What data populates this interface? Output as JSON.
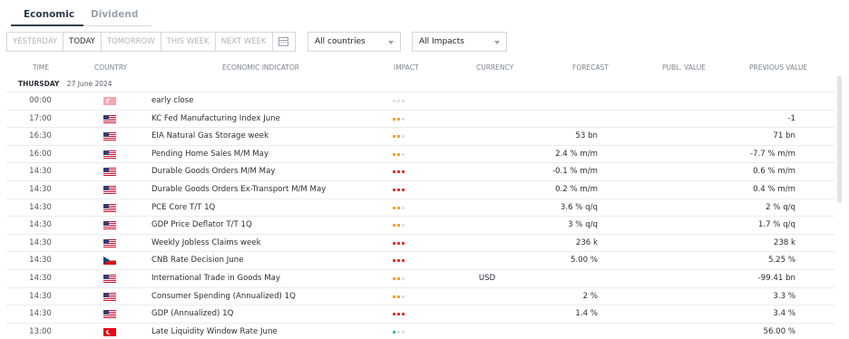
{
  "tabs": [
    {
      "label": "Economic",
      "active": true
    },
    {
      "label": "Dividend",
      "active": false
    }
  ],
  "day_filters": [
    {
      "label": "YESTERDAY",
      "active": false
    },
    {
      "label": "TODAY",
      "active": true
    },
    {
      "label": "TOMORROW",
      "active": false
    },
    {
      "label": "THIS WEEK",
      "active": false
    },
    {
      "label": "NEXT WEEK",
      "active": false
    }
  ],
  "calendar_icon": "calendar-icon",
  "filters": {
    "countries": "All countries",
    "impacts": "All Impacts"
  },
  "columns": {
    "time": "TIME",
    "country": "COUNTRY",
    "indicator": "ECONOMIC INDICATOR",
    "impact": "IMPACT",
    "currency": "CURRENCY",
    "forecast": "FORECAST",
    "publ_value": "PUBL. VALUE",
    "previous_value": "PREVIOUS VALUE"
  },
  "day": {
    "name": "THURSDAY",
    "date": "27 June 2024"
  },
  "impact_colors": {
    "high": "#e0353a",
    "medium": "#f5a623",
    "low": "#3fbf7f",
    "inactive": "#dde1e5"
  },
  "rows": [
    {
      "time": "00:00",
      "flag": "tr-light",
      "indicator": "early close",
      "impact": 0,
      "impact_color": "medium",
      "currency": "",
      "forecast": "",
      "publ_value": "",
      "previous": ""
    },
    {
      "time": "17:00",
      "flag": "us",
      "indicator": "KC Fed Manufacturing Index June",
      "impact": 2,
      "impact_color": "medium",
      "currency": "",
      "forecast": "",
      "publ_value": "",
      "previous": "-1"
    },
    {
      "time": "16:30",
      "flag": "us",
      "indicator": "EIA Natural Gas Storage week",
      "impact": 2,
      "impact_color": "medium",
      "currency": "",
      "forecast": "53 bn",
      "publ_value": "",
      "previous": "71 bn"
    },
    {
      "time": "16:00",
      "flag": "us",
      "indicator": "Pending Home Sales M/M May",
      "impact": 2,
      "impact_color": "medium",
      "currency": "",
      "forecast": "2.4 % m/m",
      "publ_value": "",
      "previous": "-7.7 % m/m"
    },
    {
      "time": "14:30",
      "flag": "us",
      "indicator": "Durable Goods Orders M/M May",
      "impact": 3,
      "impact_color": "high",
      "currency": "",
      "forecast": "-0.1 % m/m",
      "publ_value": "",
      "previous": "0.6 % m/m"
    },
    {
      "time": "14:30",
      "flag": "us",
      "indicator": "Durable Goods Orders Ex-Transport M/M May",
      "impact": 3,
      "impact_color": "high",
      "currency": "",
      "forecast": "0.2 % m/m",
      "publ_value": "",
      "previous": "0.4 % m/m"
    },
    {
      "time": "14:30",
      "flag": "us",
      "indicator": "PCE Core T/T 1Q",
      "impact": 2,
      "impact_color": "medium",
      "currency": "",
      "forecast": "3.6 % q/q",
      "publ_value": "",
      "previous": "2 % q/q"
    },
    {
      "time": "14:30",
      "flag": "us",
      "indicator": "GDP Price Deflator T/T 1Q",
      "impact": 2,
      "impact_color": "medium",
      "currency": "",
      "forecast": "3 % q/q",
      "publ_value": "",
      "previous": "1.7 % q/q"
    },
    {
      "time": "14:30",
      "flag": "us",
      "indicator": "Weekly Jobless Claims week",
      "impact": 3,
      "impact_color": "high",
      "currency": "",
      "forecast": "236 k",
      "publ_value": "",
      "previous": "238 k"
    },
    {
      "time": "14:30",
      "flag": "cz",
      "indicator": "CNB Rate Decision June",
      "impact": 3,
      "impact_color": "high",
      "currency": "",
      "forecast": "5.00 %",
      "publ_value": "",
      "previous": "5.25 %"
    },
    {
      "time": "14:30",
      "flag": "us",
      "indicator": "International Trade in Goods May",
      "impact": 2,
      "impact_color": "medium",
      "currency": "USD",
      "forecast": "",
      "publ_value": "",
      "previous": "-99.41 bn"
    },
    {
      "time": "14:30",
      "flag": "us",
      "indicator": "Consumer Spending (Annualized) 1Q",
      "impact": 2,
      "impact_color": "medium",
      "currency": "",
      "forecast": "2 %",
      "publ_value": "",
      "previous": "3.3 %"
    },
    {
      "time": "14:30",
      "flag": "us",
      "indicator": "GDP (Annualized) 1Q",
      "impact": 3,
      "impact_color": "high",
      "currency": "",
      "forecast": "1.4 %",
      "publ_value": "",
      "previous": "3.4 %"
    },
    {
      "time": "13:00",
      "flag": "tr",
      "indicator": "Late Liquidity Window Rate June",
      "impact": 1,
      "impact_color": "low",
      "currency": "",
      "forecast": "",
      "publ_value": "",
      "previous": "56.00 %"
    }
  ]
}
